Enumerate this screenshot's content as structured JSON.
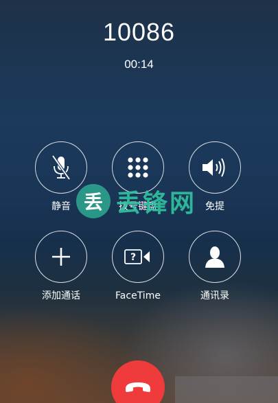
{
  "call": {
    "number": "10086",
    "duration": "00:14"
  },
  "controls": {
    "mute_label": "静音",
    "keypad_label": "拨号键盘",
    "speaker_label": "免提",
    "add_call_label": "添加通话",
    "facetime_label": "FaceTime",
    "contacts_label": "通讯录"
  },
  "icons": {
    "mute": "microphone-muted-icon",
    "keypad": "keypad-icon",
    "speaker": "speaker-icon",
    "add_call": "plus-icon",
    "facetime": "facetime-unavailable-icon",
    "contacts": "person-icon",
    "end_call": "phone-hangup-icon"
  },
  "watermark": {
    "badge": "丢",
    "text": "丢锋网"
  },
  "colors": {
    "end_call": "#ef3b3b",
    "watermark": "#30c4a0"
  }
}
